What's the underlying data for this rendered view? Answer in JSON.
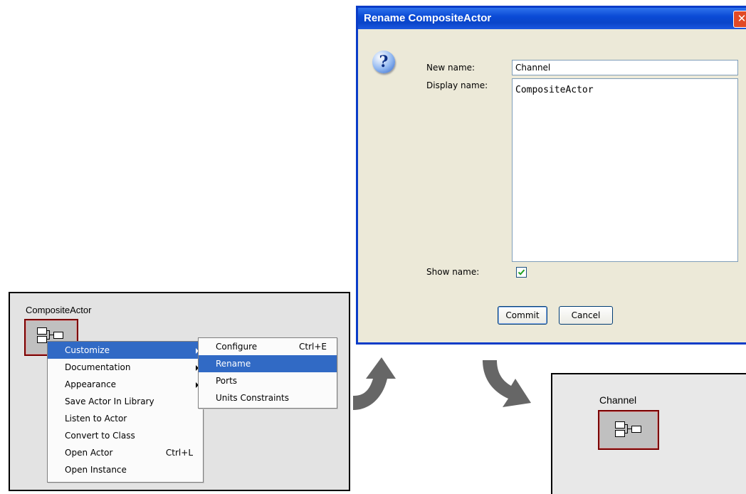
{
  "left_canvas": {
    "actor_title": "CompositeActor",
    "context_menu": [
      {
        "label": "Customize",
        "submenu": true,
        "highlighted": true
      },
      {
        "label": "Documentation",
        "submenu": true
      },
      {
        "label": "Appearance",
        "submenu": true
      },
      {
        "label": "Save Actor In Library"
      },
      {
        "label": "Listen to Actor"
      },
      {
        "label": "Convert to Class"
      },
      {
        "label": "Open Actor",
        "shortcut": "Ctrl+L"
      },
      {
        "label": "Open Instance"
      }
    ],
    "submenu": [
      {
        "label": "Configure",
        "shortcut": "Ctrl+E"
      },
      {
        "label": "Rename",
        "highlighted": true
      },
      {
        "label": "Ports"
      },
      {
        "label": "Units Constraints"
      }
    ]
  },
  "dialog": {
    "title": "Rename CompositeActor",
    "close_glyph": "✕",
    "help_glyph": "?",
    "new_name_label": "New name:",
    "new_name_value": "Channel",
    "display_name_label": "Display name:",
    "display_name_value": "CompositeActor",
    "show_name_label": "Show name:",
    "show_name_checked": true,
    "commit_label": "Commit",
    "cancel_label": "Cancel"
  },
  "right_canvas": {
    "actor_title": "Channel"
  },
  "colors": {
    "highlight": "#316ac5",
    "titlebar": "#0a4ad6",
    "actor_border": "#7a0000",
    "arrow": "#666666"
  }
}
